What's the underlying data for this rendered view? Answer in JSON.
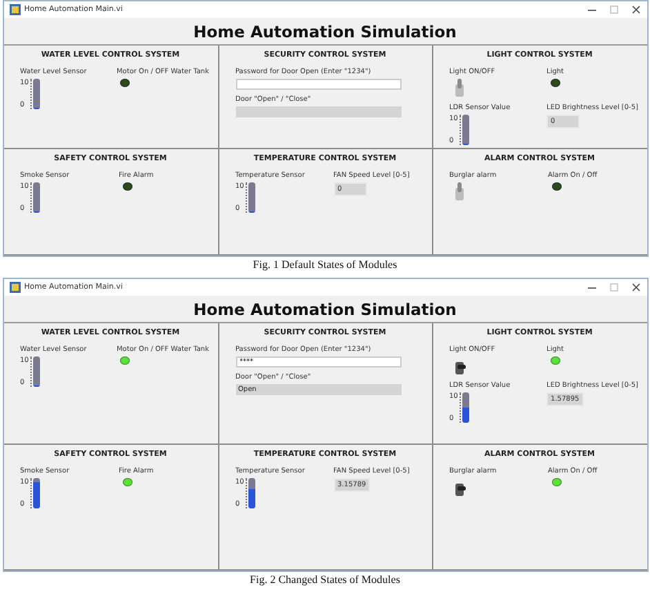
{
  "figures": [
    {
      "window": {
        "title": "Home Automation Main.vi"
      },
      "heading": "Home Automation Simulation",
      "panels": [
        {
          "title": "WATER LEVEL CONTROL SYSTEM",
          "controls": [
            {
              "kind": "tank",
              "label": "Water Level Sensor",
              "scale_max": "10",
              "scale_min": "0",
              "level": 0.03
            },
            {
              "kind": "led",
              "label": "Motor On / OFF Water Tank",
              "on": false
            }
          ]
        },
        {
          "title": "SECURITY CONTROL SYSTEM",
          "controls": [
            {
              "kind": "input",
              "label": "Password for Door Open (Enter \"1234\")"
            },
            {
              "kind": "display",
              "label": "Door \"Open\" / \"Close\""
            }
          ]
        },
        {
          "title": "LIGHT CONTROL SYSTEM",
          "controls": [
            {
              "kind": "toggle",
              "label": "Light ON/OFF",
              "on": false
            },
            {
              "kind": "led",
              "label": "Light",
              "on": false
            },
            {
              "kind": "tank",
              "label": "LDR Sensor Value",
              "scale_max": "10",
              "scale_min": "0",
              "level": 0.03
            },
            {
              "kind": "numeric",
              "label": "LED Brightness Level [0-5]",
              "value": "0"
            }
          ]
        },
        {
          "title": "SAFETY CONTROL SYSTEM",
          "controls": [
            {
              "kind": "tank",
              "label": "Smoke Sensor",
              "scale_max": "10",
              "scale_min": "0",
              "level": 0.03
            },
            {
              "kind": "led",
              "label": "Fire Alarm",
              "on": false
            }
          ]
        },
        {
          "title": "TEMPERATURE CONTROL SYSTEM",
          "controls": [
            {
              "kind": "tank",
              "label": "Temperature Sensor",
              "scale_max": "10",
              "scale_min": "0",
              "level": 0.03
            },
            {
              "kind": "numeric",
              "label": "FAN Speed Level [0-5]",
              "value": "0"
            }
          ]
        },
        {
          "title": "ALARM CONTROL SYSTEM",
          "controls": [
            {
              "kind": "toggle",
              "label": "Burglar alarm",
              "on": false
            },
            {
              "kind": "led",
              "label": "Alarm On / Off",
              "on": false
            }
          ]
        }
      ],
      "caption": "Fig. 1 Default States of Modules"
    },
    {
      "window": {
        "title": "Home Automation Main.vi"
      },
      "heading": "Home Automation Simulation",
      "panels": [
        {
          "title": "WATER LEVEL CONTROL SYSTEM",
          "controls": [
            {
              "kind": "tank",
              "label": "Water Level Sensor",
              "scale_max": "10",
              "scale_min": "0",
              "level": 0.03
            },
            {
              "kind": "led",
              "label": "Motor On / OFF Water Tank",
              "on": true
            }
          ]
        },
        {
          "title": "SECURITY CONTROL SYSTEM",
          "controls": [
            {
              "kind": "input",
              "label": "Password for Door Open (Enter \"1234\")",
              "value": "****"
            },
            {
              "kind": "display",
              "label": "Door \"Open\" / \"Close\"",
              "value": "Open"
            }
          ]
        },
        {
          "title": "LIGHT CONTROL SYSTEM",
          "controls": [
            {
              "kind": "toggle",
              "label": "Light ON/OFF",
              "on": true
            },
            {
              "kind": "led",
              "label": "Light",
              "on": true
            },
            {
              "kind": "tank",
              "label": "LDR Sensor Value",
              "scale_max": "10",
              "scale_min": "0",
              "level": 0.5
            },
            {
              "kind": "numeric",
              "label": "LED Brightness Level [0-5]",
              "value": "1.57895"
            }
          ]
        },
        {
          "title": "SAFETY CONTROL SYSTEM",
          "controls": [
            {
              "kind": "tank",
              "label": "Smoke Sensor",
              "scale_max": "10",
              "scale_min": "0",
              "level": 0.85
            },
            {
              "kind": "led",
              "label": "Fire Alarm",
              "on": true
            }
          ]
        },
        {
          "title": "TEMPERATURE CONTROL SYSTEM",
          "controls": [
            {
              "kind": "tank",
              "label": "Temperature Sensor",
              "scale_max": "10",
              "scale_min": "0",
              "level": 0.65
            },
            {
              "kind": "numeric",
              "label": "FAN Speed Level [0-5]",
              "value": "3.15789"
            }
          ]
        },
        {
          "title": "ALARM CONTROL SYSTEM",
          "controls": [
            {
              "kind": "toggle",
              "label": "Burglar alarm",
              "on": true
            },
            {
              "kind": "led",
              "label": "Alarm On / Off",
              "on": true
            }
          ]
        }
      ],
      "caption": "Fig. 2 Changed States of Modules"
    }
  ]
}
